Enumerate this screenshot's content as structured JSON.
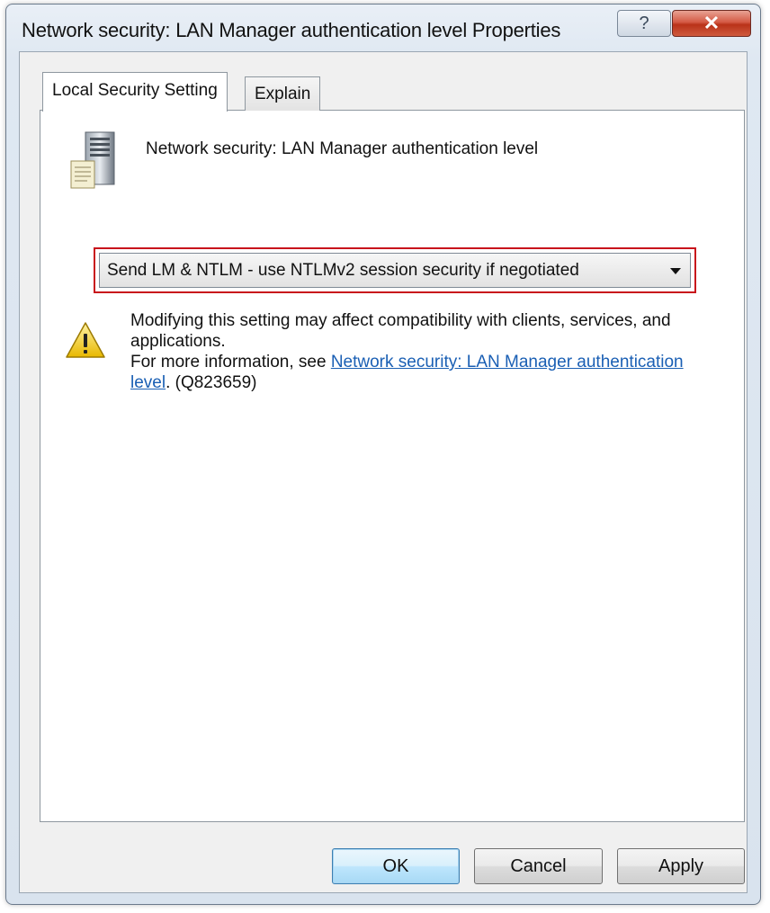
{
  "window": {
    "title": "Network security: LAN Manager authentication level Properties",
    "help_glyph": "?",
    "close_glyph": "✕"
  },
  "tabs": [
    {
      "label": "Local Security Setting",
      "active": true
    },
    {
      "label": "Explain",
      "active": false
    }
  ],
  "setting": {
    "name": "Network security: LAN Manager authentication level",
    "icon": "server-icon"
  },
  "dropdown": {
    "selected_value": "Send LM & NTLM - use NTLMv2 session security if negotiated",
    "highlight_color": "#c8141c"
  },
  "warning": {
    "icon": "warning-icon",
    "line1": "Modifying this setting may affect compatibility with clients, services, and applications.",
    "more_info_prefix": "For more information, see ",
    "link_text": "Network security: LAN Manager authentication level",
    "suffix": ". (Q823659)"
  },
  "buttons": {
    "ok": "OK",
    "cancel": "Cancel",
    "apply": "Apply"
  },
  "colors": {
    "link": "#1a5fb4",
    "close_button": "#c8432b"
  }
}
